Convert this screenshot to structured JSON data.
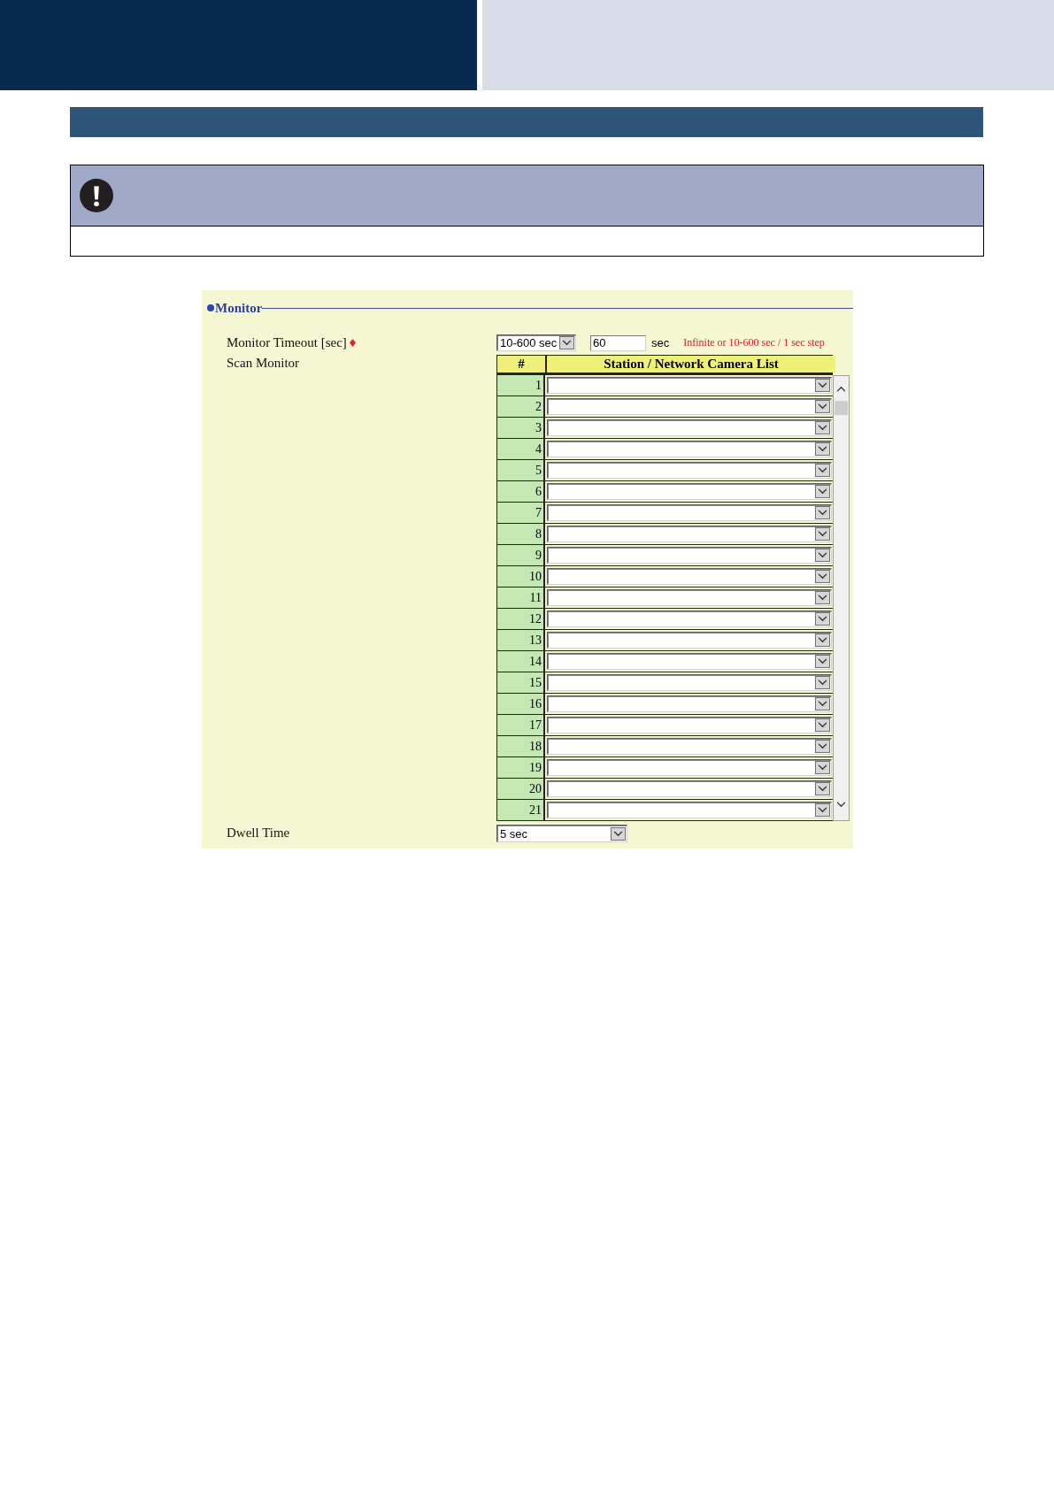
{
  "panel": {
    "title": "Monitor",
    "fields": [
      {
        "kind": "timeout",
        "label": "Monitor Timeout [sec]",
        "required": true,
        "mode": "10-600 sec",
        "value": "60",
        "unit": "sec",
        "hint": "Infinite or 10-600 sec / 1 sec step"
      },
      {
        "kind": "list",
        "label": "Scan Monitor",
        "required": false,
        "columns": [
          "#",
          "Station / Network Camera List"
        ],
        "rows": [
          {
            "number": "1"
          },
          {
            "number": "2"
          },
          {
            "number": "3"
          },
          {
            "number": "4"
          },
          {
            "number": "5"
          },
          {
            "number": "6"
          },
          {
            "number": "7"
          },
          {
            "number": "8"
          },
          {
            "number": "9"
          },
          {
            "number": "10"
          },
          {
            "number": "11"
          },
          {
            "number": "12"
          },
          {
            "number": "13"
          },
          {
            "number": "14"
          },
          {
            "number": "15"
          },
          {
            "number": "16"
          },
          {
            "number": "17"
          },
          {
            "number": "18"
          },
          {
            "number": "19"
          },
          {
            "number": "20"
          },
          {
            "number": "21"
          }
        ]
      },
      {
        "kind": "select",
        "label": "Dwell Time",
        "required": false,
        "value": "5 sec"
      }
    ]
  }
}
